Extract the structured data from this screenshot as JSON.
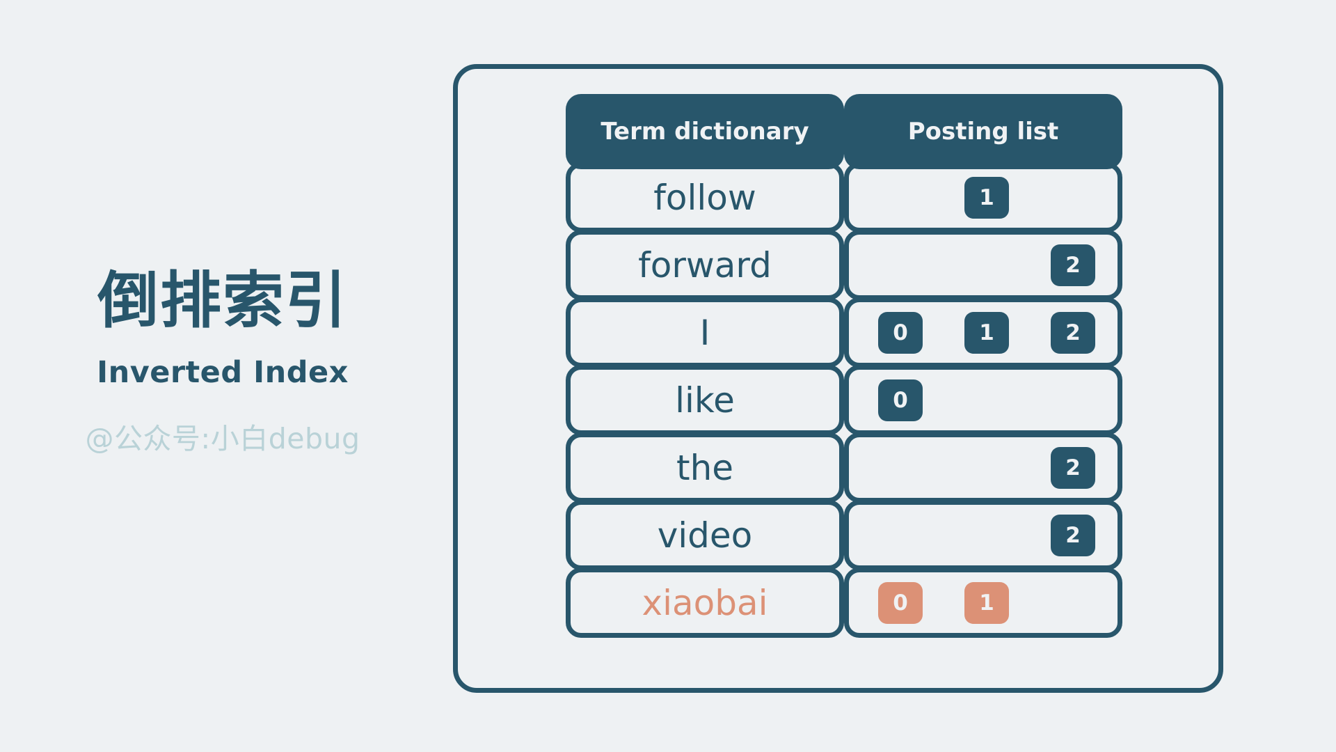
{
  "left_panel": {
    "title_cn": "倒排索引",
    "title_en": "Inverted Index",
    "watermark": "@公众号:小白debug"
  },
  "colors": {
    "background": "#eef1f3",
    "primary": "#28566b",
    "accent": "#dc9176",
    "watermark": "#b9d2d7"
  },
  "table": {
    "headers": {
      "term": "Term dictionary",
      "posting": "Posting list"
    },
    "rows": [
      {
        "term": "follow",
        "accent": false,
        "slots": [
          "",
          "1",
          ""
        ]
      },
      {
        "term": "forward",
        "accent": false,
        "slots": [
          "",
          "",
          "2"
        ]
      },
      {
        "term": "I",
        "accent": false,
        "slots": [
          "0",
          "1",
          "2"
        ]
      },
      {
        "term": "like",
        "accent": false,
        "slots": [
          "0",
          "",
          ""
        ]
      },
      {
        "term": "the",
        "accent": false,
        "slots": [
          "",
          "",
          "2"
        ]
      },
      {
        "term": "video",
        "accent": false,
        "slots": [
          "",
          "",
          "2"
        ]
      },
      {
        "term": "xiaobai",
        "accent": true,
        "slots": [
          "0",
          "1",
          ""
        ]
      }
    ]
  }
}
